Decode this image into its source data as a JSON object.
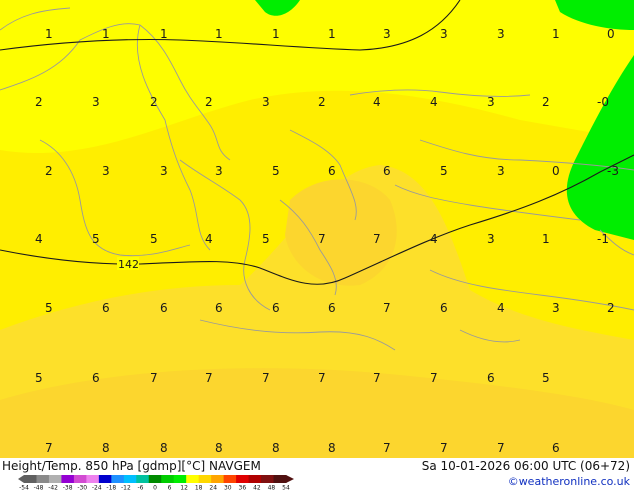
{
  "map": {
    "colors": {
      "yellow_light": "#fefe00",
      "yellow": "#ffee00",
      "yellow_orange": "#fde02a",
      "orange": "#fcd62e",
      "green": "#00ee00",
      "coast": "#9a9a9a",
      "isoline": "#1a1a1a"
    },
    "isolines": [
      {
        "name": "upper-contour",
        "label": ""
      },
      {
        "name": "lower-contour",
        "label": "142"
      }
    ],
    "grid_values": [
      [
        "1",
        "1",
        "1",
        "1",
        "1",
        "1",
        "3",
        "3",
        "3",
        "1",
        "0"
      ],
      [
        "2",
        "3",
        "2",
        "2",
        "3",
        "2",
        "4",
        "4",
        "3",
        "2",
        "-0"
      ],
      [
        "2",
        "3",
        "3",
        "3",
        "5",
        "6",
        "6",
        "5",
        "3",
        "0",
        "-3"
      ],
      [
        "4",
        "5",
        "5",
        "4",
        "5",
        "7",
        "7",
        "4",
        "3",
        "1",
        "-1"
      ],
      [
        "5",
        "6",
        "6",
        "6",
        "6",
        "6",
        "7",
        "6",
        "4",
        "3",
        "2"
      ],
      [
        "5",
        "6",
        "7",
        "7",
        "7",
        "7",
        "7",
        "7",
        "6",
        "5"
      ],
      [
        "7",
        "8",
        "8",
        "8",
        "8",
        "8",
        "7",
        "7",
        "7",
        "6"
      ]
    ]
  },
  "footer": {
    "title": "Height/Temp. 850 hPa [gdmp][°C] NAVGEM",
    "timestamp": "Sa 10-01-2026 06:00 UTC (06+72)",
    "credit": "©weatheronline.co.uk"
  },
  "legend": {
    "ticks": [
      "-54",
      "-48",
      "-42",
      "-38",
      "-30",
      "-24",
      "-18",
      "-12",
      "-6",
      "0",
      "6",
      "12",
      "18",
      "24",
      "30",
      "36",
      "42",
      "48",
      "54"
    ],
    "colors": [
      "#606060",
      "#8a8a8a",
      "#b0b0b0",
      "#9400d3",
      "#d24bd2",
      "#ee82ee",
      "#0000cd",
      "#1e90ff",
      "#00bfff",
      "#00c2a0",
      "#008b00",
      "#00cd00",
      "#00ee00",
      "#ffff00",
      "#ffd700",
      "#ffa500",
      "#ff4500",
      "#e00000",
      "#b00000",
      "#801010",
      "#501010"
    ]
  }
}
